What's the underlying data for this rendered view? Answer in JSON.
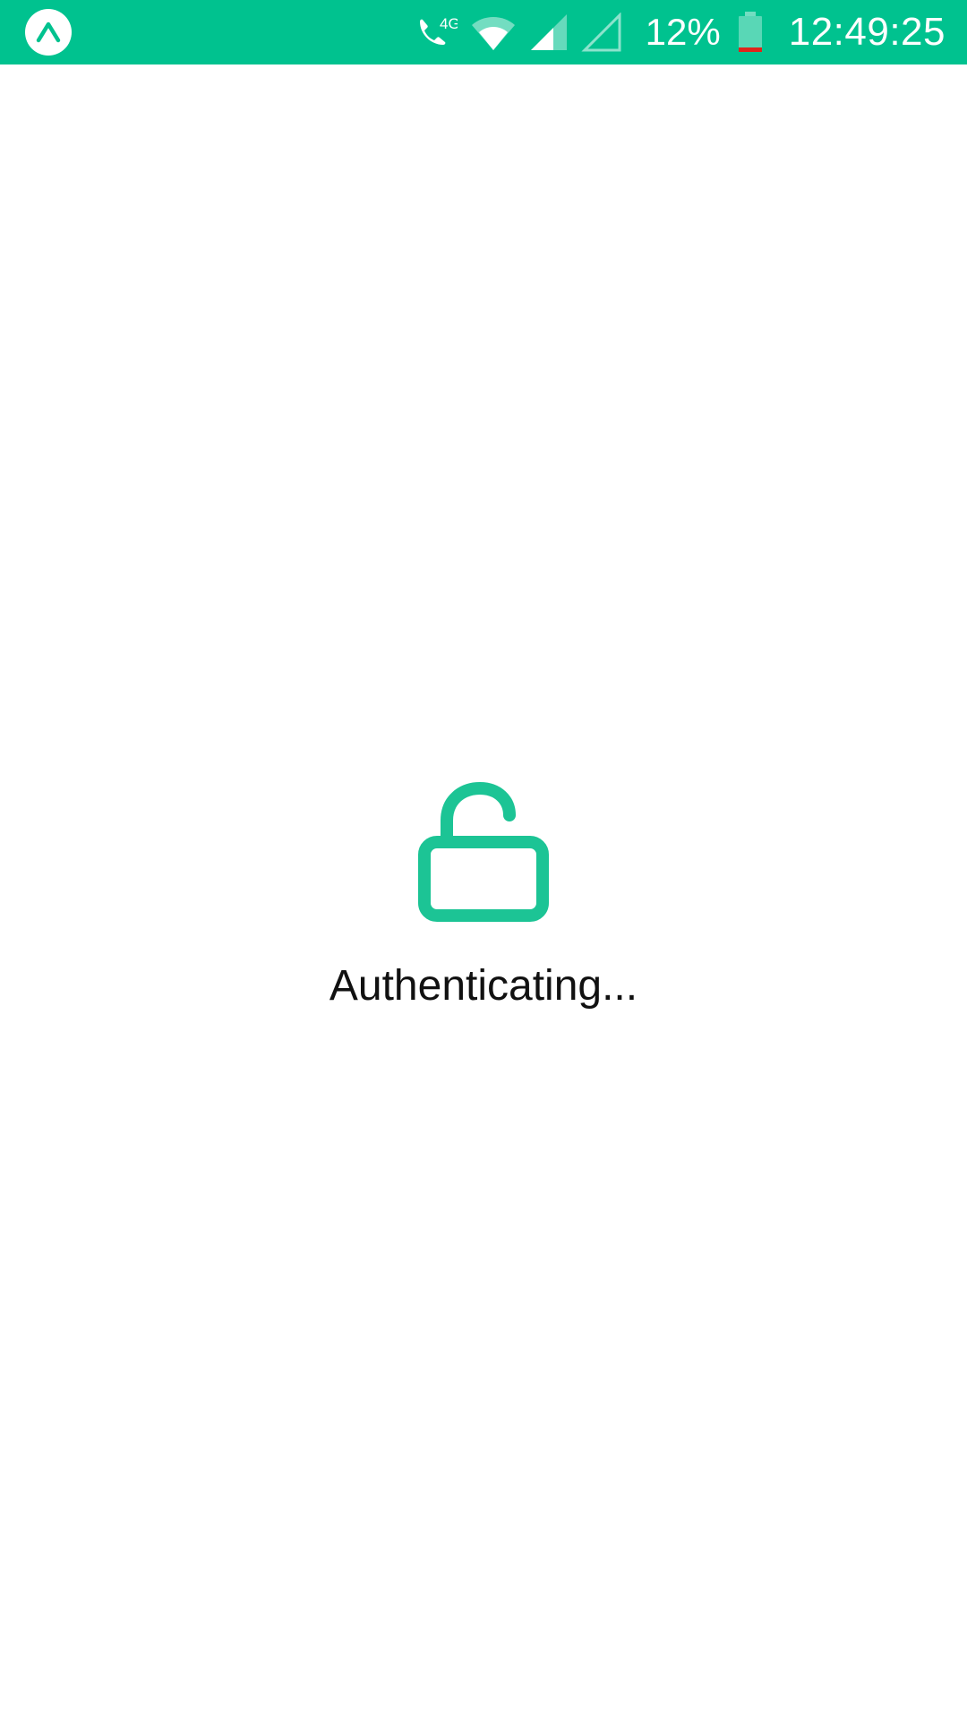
{
  "status_bar": {
    "background_color": "#00c28f",
    "app_icon": "expo-logo-icon",
    "call_network": "4G",
    "battery_percent": "12%",
    "battery_level": 0.12,
    "time": "12:49:25",
    "icons": [
      "call-4g-icon",
      "wifi-icon",
      "signal-sim1-icon",
      "signal-sim2-icon",
      "battery-icon"
    ]
  },
  "auth": {
    "icon": "unlock-icon",
    "icon_color": "#1cc495",
    "message": "Authenticating..."
  }
}
